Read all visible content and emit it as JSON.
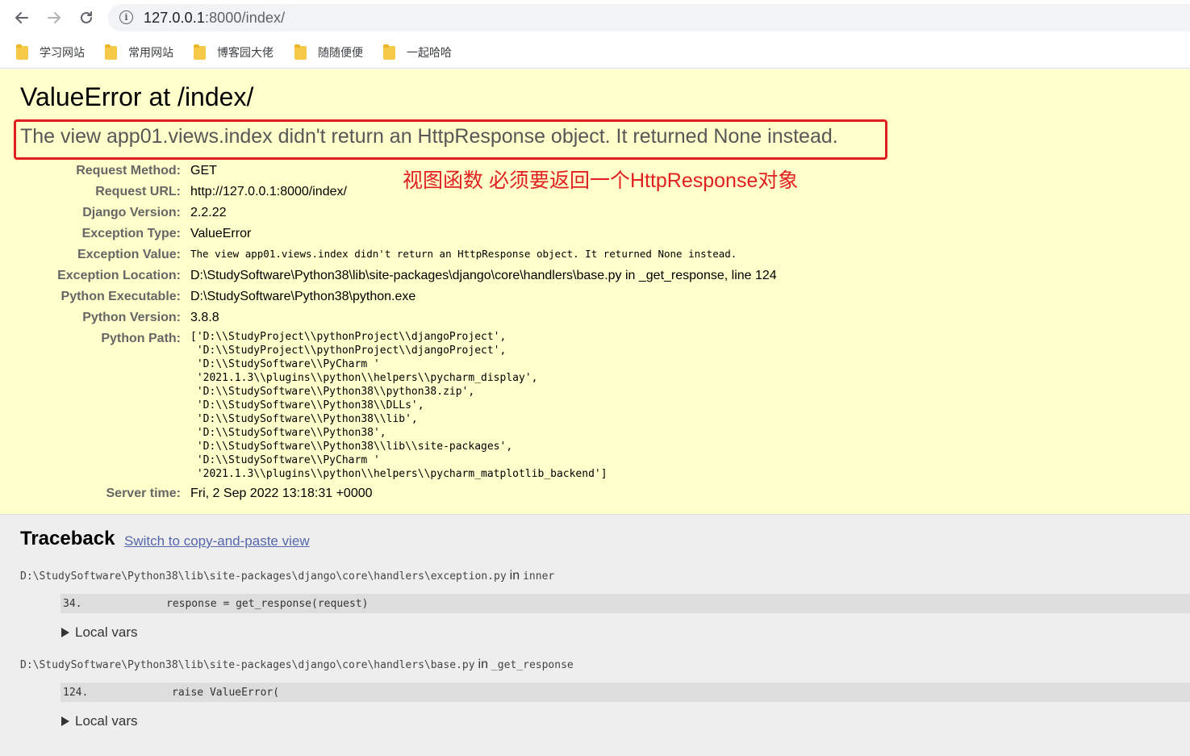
{
  "browser": {
    "url_host": "127.0.0.1",
    "url_rest": ":8000/index/",
    "bookmarks": [
      "学习网站",
      "常用网站",
      "博客园大佬",
      "随随便便",
      "一起哈哈"
    ]
  },
  "error": {
    "title": "ValueError at /index/",
    "message": "The view app01.views.index didn't return an HttpResponse object. It returned None instead.",
    "annotation": "视图函数 必须要返回一个HttpResponse对象",
    "annotation_color": "#e02020"
  },
  "meta": {
    "request_method_label": "Request Method:",
    "request_method": "GET",
    "request_url_label": "Request URL:",
    "request_url": "http://127.0.0.1:8000/index/",
    "django_version_label": "Django Version:",
    "django_version": "2.2.22",
    "exception_type_label": "Exception Type:",
    "exception_type": "ValueError",
    "exception_value_label": "Exception Value:",
    "exception_value": "The view app01.views.index didn't return an HttpResponse object. It returned None instead.",
    "exception_location_label": "Exception Location:",
    "exception_location": "D:\\StudySoftware\\Python38\\lib\\site-packages\\django\\core\\handlers\\base.py in _get_response, line 124",
    "python_executable_label": "Python Executable:",
    "python_executable": "D:\\StudySoftware\\Python38\\python.exe",
    "python_version_label": "Python Version:",
    "python_version": "3.8.8",
    "python_path_label": "Python Path:",
    "python_path": "['D:\\\\StudyProject\\\\pythonProject\\\\djangoProject',\n 'D:\\\\StudyProject\\\\pythonProject\\\\djangoProject',\n 'D:\\\\StudySoftware\\\\PyCharm '\n '2021.1.3\\\\plugins\\\\python\\\\helpers\\\\pycharm_display',\n 'D:\\\\StudySoftware\\\\Python38\\\\python38.zip',\n 'D:\\\\StudySoftware\\\\Python38\\\\DLLs',\n 'D:\\\\StudySoftware\\\\Python38\\\\lib',\n 'D:\\\\StudySoftware\\\\Python38',\n 'D:\\\\StudySoftware\\\\Python38\\\\lib\\\\site-packages',\n 'D:\\\\StudySoftware\\\\PyCharm '\n '2021.1.3\\\\plugins\\\\python\\\\helpers\\\\pycharm_matplotlib_backend']",
    "server_time_label": "Server time:",
    "server_time": "Fri, 2 Sep 2022 13:18:31 +0000"
  },
  "traceback": {
    "title": "Traceback",
    "switch_link": "Switch to copy-and-paste view",
    "in_word": "in",
    "local_vars": "Local vars",
    "frames": [
      {
        "file": "D:\\StudySoftware\\Python38\\lib\\site-packages\\django\\core\\handlers\\exception.py",
        "func": "inner",
        "line_no": "34.",
        "code": "response = get_response(request)"
      },
      {
        "file": "D:\\StudySoftware\\Python38\\lib\\site-packages\\django\\core\\handlers\\base.py",
        "func": "_get_response",
        "line_no": "124.",
        "code": "raise ValueError("
      }
    ]
  }
}
